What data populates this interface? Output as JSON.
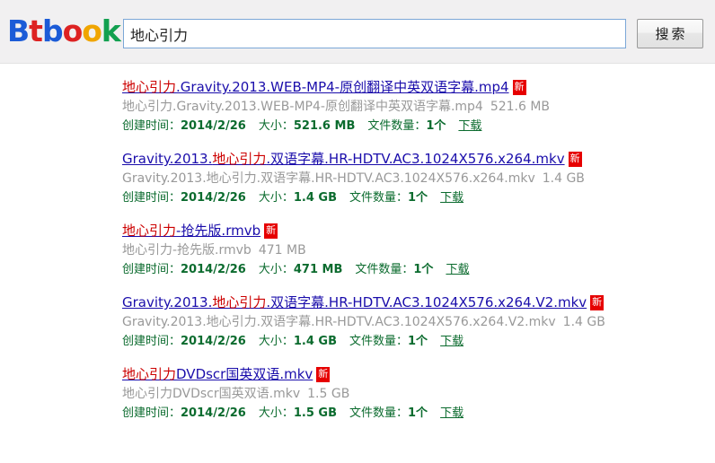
{
  "header": {
    "logo": {
      "letters": [
        {
          "char": "B",
          "color": "#1b5bd7"
        },
        {
          "char": "t",
          "color": "#dd2222"
        },
        {
          "char": "b",
          "color": "#1b5bd7"
        },
        {
          "char": "o",
          "color": "#dd2222"
        },
        {
          "char": "o",
          "color": "#f0a500"
        },
        {
          "char": "k",
          "color": "#12a050"
        }
      ],
      "text": "Btbook"
    },
    "search": {
      "value": "地心引力",
      "placeholder": ""
    },
    "search_button_label": "搜索"
  },
  "labels": {
    "created_time": "创建时间：",
    "size": "大小：",
    "file_count": "文件数量：",
    "download": "下载",
    "new_badge": "新"
  },
  "results": [
    {
      "title_prefix": "",
      "title_highlight": "地心引力",
      "title_suffix": ".Gravity.2013.WEB-MP4-原创翻译中英双语字幕.mp4",
      "description": "地心引力.Gravity.2013.WEB-MP4-原创翻译中英双语字幕.mp4",
      "desc_size": "521.6 MB",
      "created_time": "2014/2/26",
      "size": "521.6 MB",
      "file_count": "1个"
    },
    {
      "title_prefix": "Gravity.2013.",
      "title_highlight": "地心引力",
      "title_suffix": ".双语字幕.HR-HDTV.AC3.1024X576.x264.mkv",
      "description": "Gravity.2013.地心引力.双语字幕.HR-HDTV.AC3.1024X576.x264.mkv",
      "desc_size": "1.4 GB",
      "created_time": "2014/2/26",
      "size": "1.4 GB",
      "file_count": "1个"
    },
    {
      "title_prefix": "",
      "title_highlight": "地心引力",
      "title_suffix": "-抢先版.rmvb",
      "description": "地心引力-抢先版.rmvb",
      "desc_size": "471 MB",
      "created_time": "2014/2/26",
      "size": "471 MB",
      "file_count": "1个"
    },
    {
      "title_prefix": "Gravity.2013.",
      "title_highlight": "地心引力",
      "title_suffix": ".双语字幕.HR-HDTV.AC3.1024X576.x264.V2.mkv",
      "description": "Gravity.2013.地心引力.双语字幕.HR-HDTV.AC3.1024X576.x264.V2.mkv",
      "desc_size": "1.4 GB",
      "created_time": "2014/2/26",
      "size": "1.4 GB",
      "file_count": "1个"
    },
    {
      "title_prefix": "",
      "title_highlight": "地心引力",
      "title_suffix": "DVDscr国英双语.mkv",
      "description": "地心引力DVDscr国英双语.mkv",
      "desc_size": "1.5 GB",
      "created_time": "2014/2/26",
      "size": "1.5 GB",
      "file_count": "1个"
    }
  ],
  "colors": {
    "link": "#1a0dab",
    "highlight": "#cc0000",
    "meta_green": "#0b6b2e",
    "desc_gray": "#999999",
    "badge_red": "#e60000",
    "header_bg": "#f1f0f1"
  }
}
